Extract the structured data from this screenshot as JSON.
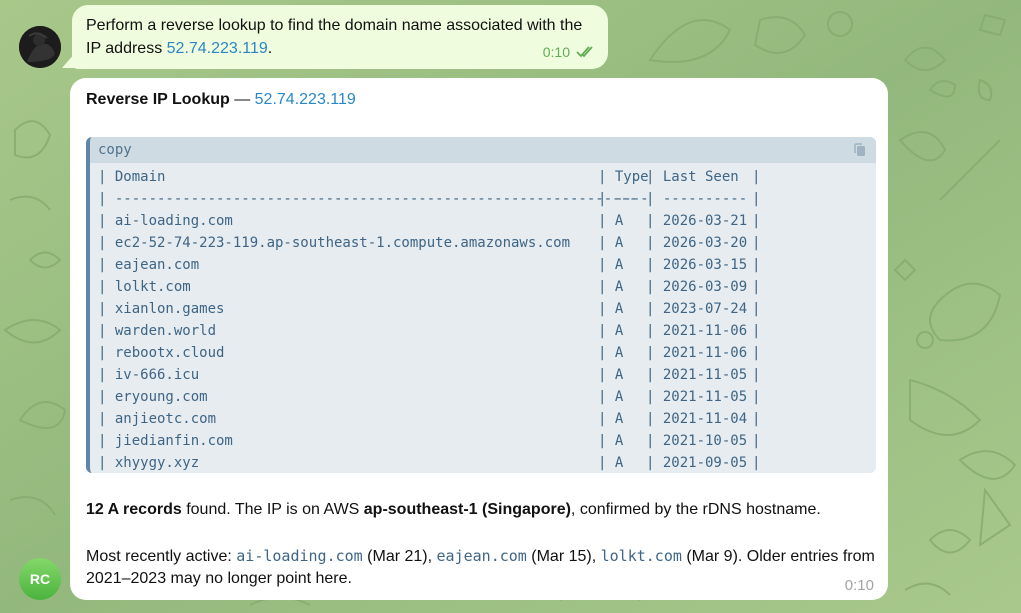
{
  "colors": {
    "wallpaper": "#9ebf83",
    "outgoing_bubble": "#effdde",
    "incoming_bubble": "#ffffff",
    "link": "#2a87c5",
    "code_bg": "#e6ecef",
    "code_text": "#3e6585",
    "time_outgoing": "#62ac55",
    "time_incoming": "#a3a3a3",
    "avatar_bot": "#5cc04a"
  },
  "outgoing_message": {
    "text_before": "Perform a reverse lookup to find the domain name associated with the IP address ",
    "ip": "52.74.223.119",
    "text_after": ".",
    "time": "0:10",
    "status_icon": "double-check-icon"
  },
  "incoming_message": {
    "title_bold": "Reverse IP Lookup",
    "title_dash": " — ",
    "title_ip": "52.74.223.119",
    "code_block": {
      "language": "copy",
      "copy_icon": "copy-icon",
      "header": {
        "domain": "Domain",
        "type": "Type",
        "last_seen": "Last Seen"
      },
      "divider": {
        "domain": "--------------------------------------------------------------",
        "type": "----",
        "last_seen": "----------"
      },
      "rows": [
        {
          "domain": "ai-loading.com",
          "type": "A",
          "last_seen": "2026-03-21"
        },
        {
          "domain": "ec2-52-74-223-119.ap-southeast-1.compute.amazonaws.com",
          "type": "A",
          "last_seen": "2026-03-20"
        },
        {
          "domain": "eajean.com",
          "type": "A",
          "last_seen": "2026-03-15"
        },
        {
          "domain": "lolkt.com",
          "type": "A",
          "last_seen": "2026-03-09"
        },
        {
          "domain": "xianlon.games",
          "type": "A",
          "last_seen": "2023-07-24"
        },
        {
          "domain": "warden.world",
          "type": "A",
          "last_seen": "2021-11-06"
        },
        {
          "domain": "rebootx.cloud",
          "type": "A",
          "last_seen": "2021-11-06"
        },
        {
          "domain": "iv-666.icu",
          "type": "A",
          "last_seen": "2021-11-05"
        },
        {
          "domain": "eryoung.com",
          "type": "A",
          "last_seen": "2021-11-05"
        },
        {
          "domain": "anjieotc.com",
          "type": "A",
          "last_seen": "2021-11-04"
        },
        {
          "domain": "jiedianfin.com",
          "type": "A",
          "last_seen": "2021-10-05"
        },
        {
          "domain": "xhyygy.xyz",
          "type": "A",
          "last_seen": "2021-09-05"
        }
      ]
    },
    "summary": {
      "count_bold": "12 A records",
      "mid": " found. The IP is on AWS ",
      "region_bold": "ap-southeast-1 (Singapore)",
      "end": ", confirmed by the rDNS hostname."
    },
    "detail": {
      "prefix": "Most recently active: ",
      "d1": "ai-loading.com",
      "d1_note": " (Mar 21), ",
      "d2": "eajean.com",
      "d2_note": " (Mar 15), ",
      "d3": "lolkt.com",
      "d3_note": " (Mar 9). Older entries from 2021–2023 may no longer point here."
    },
    "time": "0:10"
  },
  "bot_avatar": {
    "initials": "RC"
  }
}
